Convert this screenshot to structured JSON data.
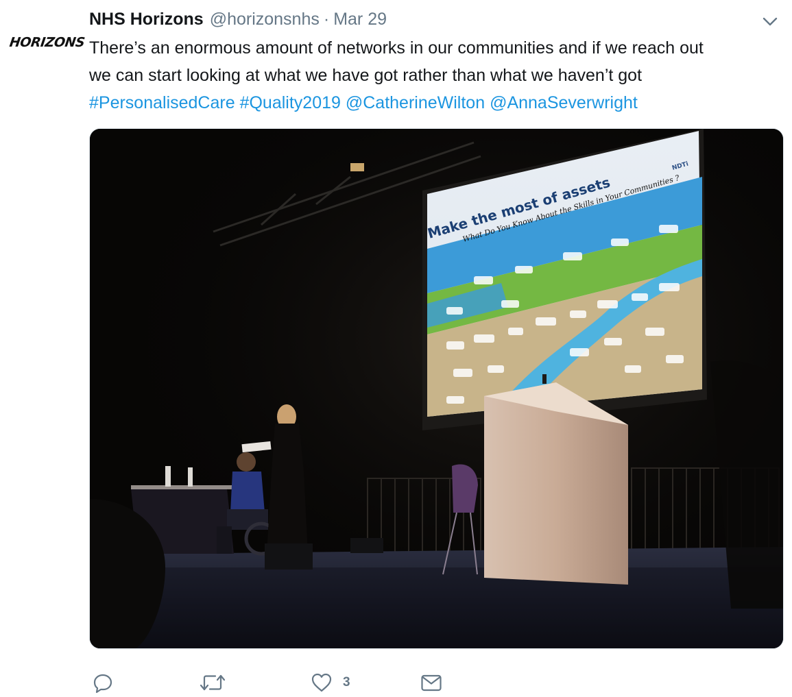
{
  "tweet": {
    "avatar_text": "HORIZONS",
    "display_name": "NHS Horizons",
    "handle": "@horizonsnhs",
    "separator": "·",
    "date": "Mar 29",
    "text_line1": "There’s an enormous amount of networks in our communities and if we reach out",
    "text_line2": "we can start looking at what we have got rather than what we haven’t got",
    "hashtags": [
      "#PersonalisedCare",
      "#Quality2019"
    ],
    "mentions": [
      "@CatherineWilton",
      "@AnnaSeverwright"
    ]
  },
  "media": {
    "slide_title": "Make the most of assets",
    "slide_subtitle": "What Do You Know About the Skills in Your Communities ?",
    "slide_logo": "NDTi"
  },
  "actions": {
    "reply_icon": "reply-icon",
    "retweet_icon": "retweet-icon",
    "like_icon": "heart-icon",
    "like_count": "3",
    "message_icon": "mail-icon"
  },
  "colors": {
    "link": "#1b95e0",
    "muted": "#657786",
    "text": "#14171a"
  }
}
